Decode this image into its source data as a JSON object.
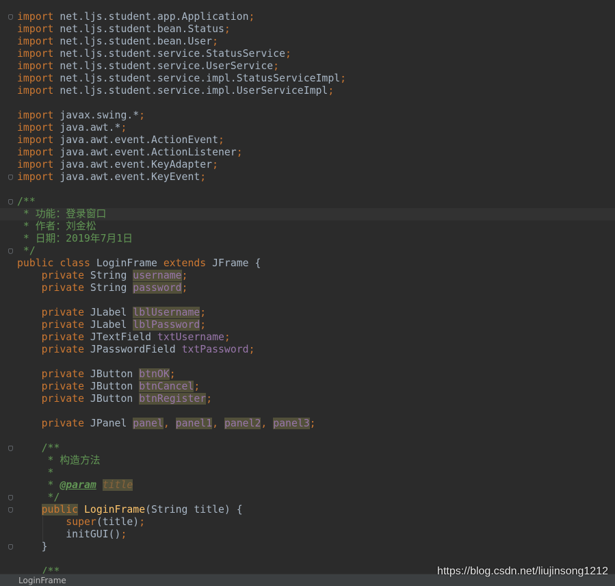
{
  "editor": {
    "lines": [
      [
        {
          "t": "import",
          "c": "kw"
        },
        {
          "t": " net.ljs.student.app.Application"
        },
        {
          "t": ";",
          "c": "sc"
        }
      ],
      [
        {
          "t": "import",
          "c": "kw"
        },
        {
          "t": " net.ljs.student.bean.Status"
        },
        {
          "t": ";",
          "c": "sc"
        }
      ],
      [
        {
          "t": "import",
          "c": "kw"
        },
        {
          "t": " net.ljs.student.bean.User"
        },
        {
          "t": ";",
          "c": "sc"
        }
      ],
      [
        {
          "t": "import",
          "c": "kw"
        },
        {
          "t": " net.ljs.student.service.StatusService"
        },
        {
          "t": ";",
          "c": "sc"
        }
      ],
      [
        {
          "t": "import",
          "c": "kw"
        },
        {
          "t": " net.ljs.student.service.UserService"
        },
        {
          "t": ";",
          "c": "sc"
        }
      ],
      [
        {
          "t": "import",
          "c": "kw"
        },
        {
          "t": " net.ljs.student.service.impl.StatusServiceImpl"
        },
        {
          "t": ";",
          "c": "sc"
        }
      ],
      [
        {
          "t": "import",
          "c": "kw"
        },
        {
          "t": " net.ljs.student.service.impl.UserServiceImpl"
        },
        {
          "t": ";",
          "c": "sc"
        }
      ],
      [],
      [
        {
          "t": "import",
          "c": "kw"
        },
        {
          "t": " javax.swing.*"
        },
        {
          "t": ";",
          "c": "sc"
        }
      ],
      [
        {
          "t": "import",
          "c": "kw"
        },
        {
          "t": " java.awt.*"
        },
        {
          "t": ";",
          "c": "sc"
        }
      ],
      [
        {
          "t": "import",
          "c": "kw"
        },
        {
          "t": " java.awt.event.ActionEvent"
        },
        {
          "t": ";",
          "c": "sc"
        }
      ],
      [
        {
          "t": "import",
          "c": "kw"
        },
        {
          "t": " java.awt.event.ActionListener"
        },
        {
          "t": ";",
          "c": "sc"
        }
      ],
      [
        {
          "t": "import",
          "c": "kw"
        },
        {
          "t": " java.awt.event.KeyAdapter"
        },
        {
          "t": ";",
          "c": "sc"
        }
      ],
      [
        {
          "t": "import",
          "c": "kw"
        },
        {
          "t": " java.awt.event.KeyEvent"
        },
        {
          "t": ";",
          "c": "sc"
        }
      ],
      [],
      [
        {
          "t": "/**",
          "c": "doc"
        }
      ],
      [
        {
          "t": " * ",
          "c": "doc"
        },
        {
          "t": "功能：登录窗口",
          "c": "doc cn"
        }
      ],
      [
        {
          "t": " * ",
          "c": "doc"
        },
        {
          "t": "作者：刘金松",
          "c": "doc cn"
        }
      ],
      [
        {
          "t": " * ",
          "c": "doc"
        },
        {
          "t": "日期：",
          "c": "doc cn"
        },
        {
          "t": "2019",
          "c": "doc"
        },
        {
          "t": "年",
          "c": "doc cn"
        },
        {
          "t": "7",
          "c": "doc"
        },
        {
          "t": "月",
          "c": "doc cn"
        },
        {
          "t": "1",
          "c": "doc"
        },
        {
          "t": "日",
          "c": "doc cn"
        }
      ],
      [
        {
          "t": " */",
          "c": "doc"
        }
      ],
      [
        {
          "t": "public class ",
          "c": "kw"
        },
        {
          "t": "LoginFrame "
        },
        {
          "t": "extends ",
          "c": "kw"
        },
        {
          "t": "JFrame {"
        }
      ],
      [
        {
          "t": "    "
        },
        {
          "t": "private ",
          "c": "kw"
        },
        {
          "t": "String "
        },
        {
          "t": "username",
          "c": "fld mk"
        },
        {
          "t": ";",
          "c": "sc"
        }
      ],
      [
        {
          "t": "    "
        },
        {
          "t": "private ",
          "c": "kw"
        },
        {
          "t": "String "
        },
        {
          "t": "password",
          "c": "fld mk"
        },
        {
          "t": ";",
          "c": "sc"
        }
      ],
      [],
      [
        {
          "t": "    "
        },
        {
          "t": "private ",
          "c": "kw"
        },
        {
          "t": "JLabel "
        },
        {
          "t": "lblUsername",
          "c": "fld mk"
        },
        {
          "t": ";",
          "c": "sc"
        }
      ],
      [
        {
          "t": "    "
        },
        {
          "t": "private ",
          "c": "kw"
        },
        {
          "t": "JLabel "
        },
        {
          "t": "lblPassword",
          "c": "fld mk"
        },
        {
          "t": ";",
          "c": "sc"
        }
      ],
      [
        {
          "t": "    "
        },
        {
          "t": "private ",
          "c": "kw"
        },
        {
          "t": "JTextField "
        },
        {
          "t": "txtUsername",
          "c": "fld"
        },
        {
          "t": ";",
          "c": "sc"
        }
      ],
      [
        {
          "t": "    "
        },
        {
          "t": "private ",
          "c": "kw"
        },
        {
          "t": "JPasswordField "
        },
        {
          "t": "txtPassword",
          "c": "fld"
        },
        {
          "t": ";",
          "c": "sc"
        }
      ],
      [],
      [
        {
          "t": "    "
        },
        {
          "t": "private ",
          "c": "kw"
        },
        {
          "t": "JButton "
        },
        {
          "t": "btnOK",
          "c": "fld mk"
        },
        {
          "t": ";",
          "c": "sc"
        }
      ],
      [
        {
          "t": "    "
        },
        {
          "t": "private ",
          "c": "kw"
        },
        {
          "t": "JButton "
        },
        {
          "t": "btnCancel",
          "c": "fld mk"
        },
        {
          "t": ";",
          "c": "sc"
        }
      ],
      [
        {
          "t": "    "
        },
        {
          "t": "private ",
          "c": "kw"
        },
        {
          "t": "JButton "
        },
        {
          "t": "btnRegister",
          "c": "fld mk"
        },
        {
          "t": ";",
          "c": "sc"
        }
      ],
      [],
      [
        {
          "t": "    "
        },
        {
          "t": "private ",
          "c": "kw"
        },
        {
          "t": "JPanel "
        },
        {
          "t": "panel",
          "c": "fld mk"
        },
        {
          "t": ", ",
          "c": "sc"
        },
        {
          "t": "panel1",
          "c": "fld mk"
        },
        {
          "t": ", ",
          "c": "sc"
        },
        {
          "t": "panel2",
          "c": "fld mk"
        },
        {
          "t": ", ",
          "c": "sc"
        },
        {
          "t": "panel3",
          "c": "fld mk"
        },
        {
          "t": ";",
          "c": "sc"
        }
      ],
      [],
      [
        {
          "t": "    "
        },
        {
          "t": "/**",
          "c": "doc"
        }
      ],
      [
        {
          "t": "     * ",
          "c": "doc"
        },
        {
          "t": "构造方法",
          "c": "doc cn"
        }
      ],
      [
        {
          "t": "     *",
          "c": "doc"
        }
      ],
      [
        {
          "t": "     * ",
          "c": "doc"
        },
        {
          "t": "@param",
          "c": "tag"
        },
        {
          "t": " "
        },
        {
          "t": "title",
          "c": "tagv"
        }
      ],
      [
        {
          "t": "     */",
          "c": "doc"
        }
      ],
      [
        {
          "t": "    "
        },
        {
          "t": "public",
          "c": "kw mk"
        },
        {
          "t": " "
        },
        {
          "t": "LoginFrame",
          "c": "fn"
        },
        {
          "t": "(String title) {"
        }
      ],
      [
        {
          "t": "        "
        },
        {
          "t": "super",
          "c": "kw"
        },
        {
          "t": "(title)"
        },
        {
          "t": ";",
          "c": "sc"
        }
      ],
      [
        {
          "t": "        initGUI()"
        },
        {
          "t": ";",
          "c": "sc"
        }
      ],
      [
        {
          "t": "    }"
        }
      ],
      [],
      [
        {
          "t": "    "
        },
        {
          "t": "/**",
          "c": "doc"
        }
      ]
    ]
  },
  "highlighted_line": 16,
  "fold_markers": [
    0,
    13,
    15,
    19,
    35,
    39,
    40,
    43
  ],
  "statusbar": {
    "breadcrumb": "LoginFrame"
  },
  "watermark": "https://blog.csdn.net/liujinsong1212"
}
